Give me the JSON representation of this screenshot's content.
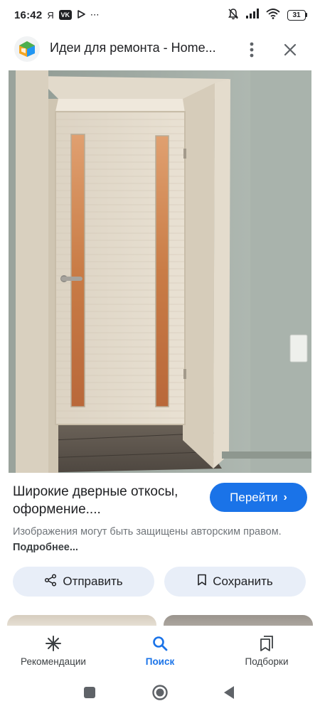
{
  "status_bar": {
    "time": "16:42",
    "carrier_letter": "Я",
    "vk": "VK",
    "dots": "⋯",
    "battery": "31"
  },
  "header": {
    "title": "Идеи для ремонта - Home..."
  },
  "result": {
    "title": "Широкие дверные откосы, оформение....",
    "goto_label": "Перейти",
    "goto_chevron": "›",
    "copyright_text": "Изображения могут быть защищены авторским правом.",
    "copyright_link": "Подробнее..."
  },
  "actions": {
    "share_label": "Отправить",
    "save_label": "Сохранить"
  },
  "bottom_nav": {
    "items": [
      {
        "label": "Рекомендации",
        "icon": "asterisk-icon",
        "active": false
      },
      {
        "label": "Поиск",
        "icon": "search-icon",
        "active": true
      },
      {
        "label": "Подборки",
        "icon": "collections-icon",
        "active": false
      }
    ]
  },
  "colors": {
    "accent": "#1a73e8",
    "chip_bg": "#e8eef8",
    "text_secondary": "#70757a"
  },
  "icons": {
    "share": "share-icon",
    "save": "bookmark-icon",
    "more": "more-vert-icon",
    "close": "close-icon",
    "site": "home-design-logo-icon"
  }
}
